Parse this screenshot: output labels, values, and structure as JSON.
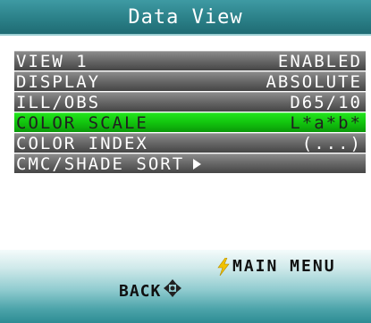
{
  "header": {
    "title": "Data View"
  },
  "menu": {
    "items": [
      {
        "label": "VIEW 1",
        "value": "ENABLED",
        "selected": false
      },
      {
        "label": "DISPLAY",
        "value": "ABSOLUTE",
        "selected": false
      },
      {
        "label": "ILL/OBS",
        "value": "D65/10",
        "selected": false
      },
      {
        "label": "COLOR SCALE",
        "value": "L*a*b*",
        "selected": true
      },
      {
        "label": "COLOR INDEX",
        "value": "(...)",
        "selected": false
      },
      {
        "label": "CMC/SHADE SORT",
        "value": "",
        "selected": false
      }
    ]
  },
  "footer": {
    "main_menu_label": "MAIN MENU",
    "back_label": "BACK",
    "main_menu_icon": "lightning-bolt-icon",
    "back_icon": "dpad-icon"
  },
  "colors": {
    "title_bar": "#2b8088",
    "selected_row": "#12c40e",
    "row": "#6d6d6d",
    "bolt": "#f2c200"
  }
}
